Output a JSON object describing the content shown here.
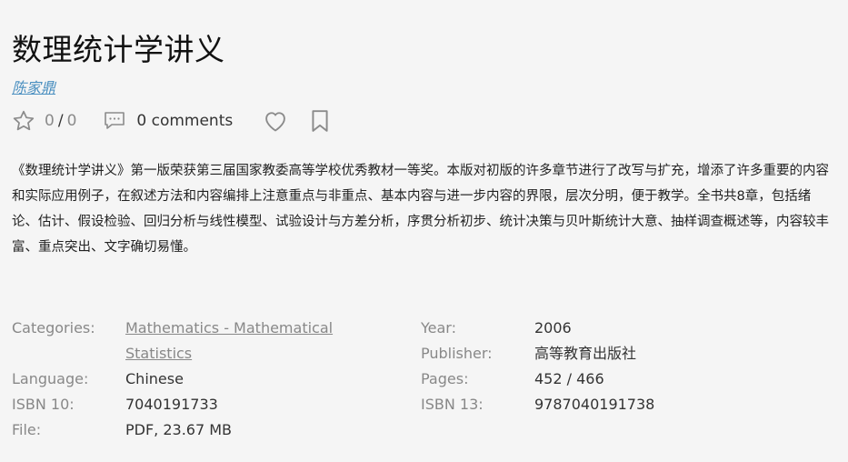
{
  "book": {
    "title": "数理统计学讲义",
    "author": "陈家鼎"
  },
  "actions": {
    "rating_value": "0",
    "rating_sep": "/",
    "rating_count": "0",
    "comments_label": "0 comments",
    "icons": [
      "star-icon",
      "comment-icon",
      "heart-icon",
      "bookmark-icon"
    ]
  },
  "description": "《数理统计学讲义》第一版荣获第三届国家教委高等学校优秀教材一等奖。本版对初版的许多章节进行了改写与扩充，增添了许多重要的内容和实际应用例子，在叙述方法和内容编排上注意重点与非重点、基本内容与进一步内容的界限，层次分明，便于教学。全书共8章，包括绪论、估计、假设检验、回归分析与线性模型、试验设计与方差分析，序贯分析初步、统计决策与贝叶斯统计大意、抽样调查概述等，内容较丰富、重点突出、文字确切易懂。",
  "details": {
    "categories_label": "Categories:",
    "categories_value_line1": "Mathematics - Mathematical",
    "categories_value_line2": "Statistics",
    "language_label": "Language:",
    "language_value": "Chinese",
    "isbn10_label": "ISBN 10:",
    "isbn10_value": "7040191733",
    "file_label": "File:",
    "file_value": "PDF, 23.67 MB",
    "year_label": "Year:",
    "year_value": "2006",
    "publisher_label": "Publisher:",
    "publisher_value": "高等教育出版社",
    "pages_label": "Pages:",
    "pages_value": "452 / 466",
    "isbn13_label": "ISBN 13:",
    "isbn13_value": "9787040191738"
  },
  "colors": {
    "background": "#f5f5f5",
    "author_link": "#4a8fc0",
    "label": "#888888",
    "text": "#333333"
  }
}
